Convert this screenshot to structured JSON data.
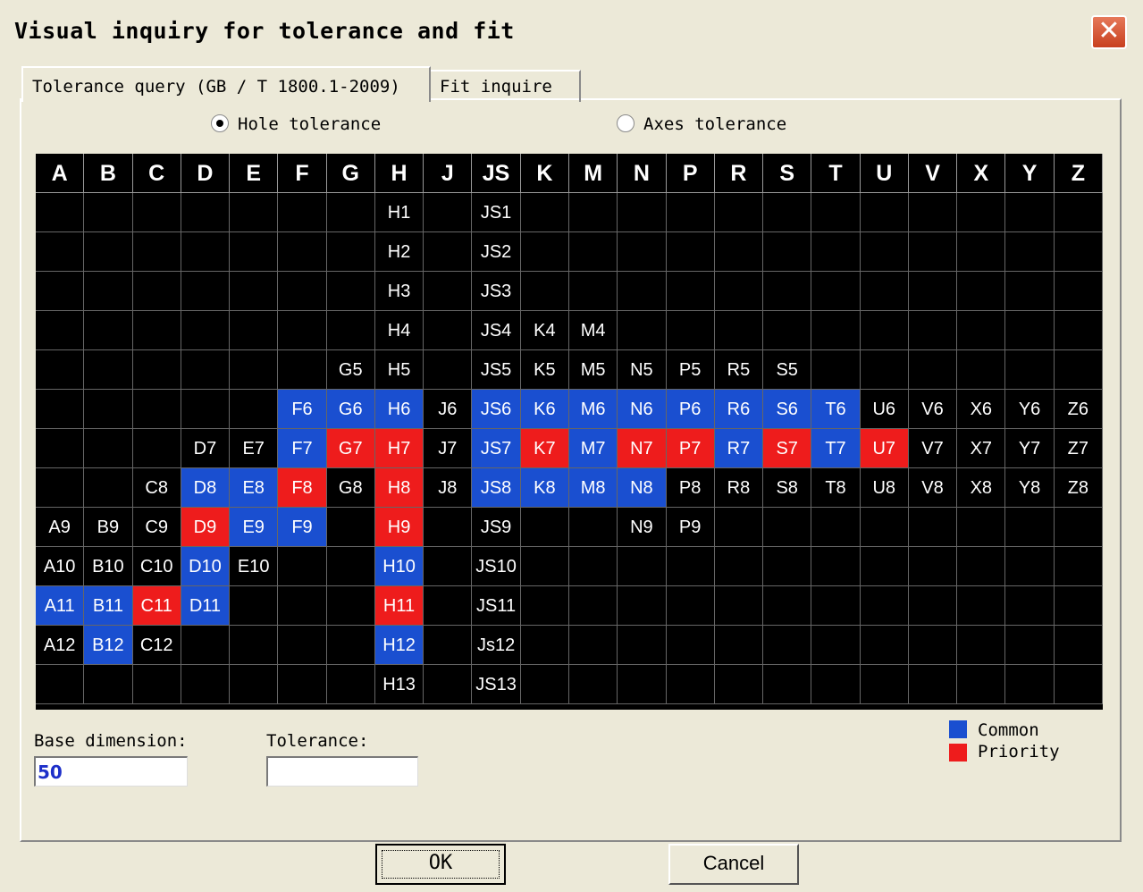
{
  "window": {
    "title": "Visual inquiry for tolerance and fit"
  },
  "tabs": [
    "Tolerance query (GB / T 1800.1-2009)",
    "Fit inquire"
  ],
  "radios": {
    "hole": "Hole tolerance",
    "axes": "Axes tolerance",
    "selected": "hole"
  },
  "grid": {
    "columns": [
      "A",
      "B",
      "C",
      "D",
      "E",
      "F",
      "G",
      "H",
      "J",
      "JS",
      "K",
      "M",
      "N",
      "P",
      "R",
      "S",
      "T",
      "U",
      "V",
      "X",
      "Y",
      "Z"
    ],
    "rows": [
      [
        [
          "",
          ""
        ],
        [
          "",
          ""
        ],
        [
          "",
          ""
        ],
        [
          "",
          ""
        ],
        [
          "",
          ""
        ],
        [
          "",
          ""
        ],
        [
          "",
          ""
        ],
        [
          "H1",
          ""
        ],
        [
          "",
          ""
        ],
        [
          "JS1",
          ""
        ],
        [
          "",
          ""
        ],
        [
          "",
          ""
        ],
        [
          "",
          ""
        ],
        [
          "",
          ""
        ],
        [
          "",
          ""
        ],
        [
          "",
          ""
        ],
        [
          "",
          ""
        ],
        [
          "",
          ""
        ],
        [
          "",
          ""
        ],
        [
          "",
          ""
        ],
        [
          "",
          ""
        ],
        [
          "",
          ""
        ]
      ],
      [
        [
          "",
          ""
        ],
        [
          "",
          ""
        ],
        [
          "",
          ""
        ],
        [
          "",
          ""
        ],
        [
          "",
          ""
        ],
        [
          "",
          ""
        ],
        [
          "",
          ""
        ],
        [
          "H2",
          ""
        ],
        [
          "",
          ""
        ],
        [
          "JS2",
          ""
        ],
        [
          "",
          ""
        ],
        [
          "",
          ""
        ],
        [
          "",
          ""
        ],
        [
          "",
          ""
        ],
        [
          "",
          ""
        ],
        [
          "",
          ""
        ],
        [
          "",
          ""
        ],
        [
          "",
          ""
        ],
        [
          "",
          ""
        ],
        [
          "",
          ""
        ],
        [
          "",
          ""
        ],
        [
          "",
          ""
        ]
      ],
      [
        [
          "",
          ""
        ],
        [
          "",
          ""
        ],
        [
          "",
          ""
        ],
        [
          "",
          ""
        ],
        [
          "",
          ""
        ],
        [
          "",
          ""
        ],
        [
          "",
          ""
        ],
        [
          "H3",
          ""
        ],
        [
          "",
          ""
        ],
        [
          "JS3",
          ""
        ],
        [
          "",
          ""
        ],
        [
          "",
          ""
        ],
        [
          "",
          ""
        ],
        [
          "",
          ""
        ],
        [
          "",
          ""
        ],
        [
          "",
          ""
        ],
        [
          "",
          ""
        ],
        [
          "",
          ""
        ],
        [
          "",
          ""
        ],
        [
          "",
          ""
        ],
        [
          "",
          ""
        ],
        [
          "",
          ""
        ]
      ],
      [
        [
          "",
          ""
        ],
        [
          "",
          ""
        ],
        [
          "",
          ""
        ],
        [
          "",
          ""
        ],
        [
          "",
          ""
        ],
        [
          "",
          ""
        ],
        [
          "",
          ""
        ],
        [
          "H4",
          ""
        ],
        [
          "",
          ""
        ],
        [
          "JS4",
          ""
        ],
        [
          "K4",
          ""
        ],
        [
          "M4",
          ""
        ],
        [
          "",
          ""
        ],
        [
          "",
          ""
        ],
        [
          "",
          ""
        ],
        [
          "",
          ""
        ],
        [
          "",
          ""
        ],
        [
          "",
          ""
        ],
        [
          "",
          ""
        ],
        [
          "",
          ""
        ],
        [
          "",
          ""
        ],
        [
          "",
          ""
        ]
      ],
      [
        [
          "",
          ""
        ],
        [
          "",
          ""
        ],
        [
          "",
          ""
        ],
        [
          "",
          ""
        ],
        [
          "",
          ""
        ],
        [
          "",
          ""
        ],
        [
          "G5",
          ""
        ],
        [
          "H5",
          ""
        ],
        [
          "",
          ""
        ],
        [
          "JS5",
          ""
        ],
        [
          "K5",
          ""
        ],
        [
          "M5",
          ""
        ],
        [
          "N5",
          ""
        ],
        [
          "P5",
          ""
        ],
        [
          "R5",
          ""
        ],
        [
          "S5",
          ""
        ],
        [
          "",
          ""
        ],
        [
          "",
          ""
        ],
        [
          "",
          ""
        ],
        [
          "",
          ""
        ],
        [
          "",
          ""
        ],
        [
          "",
          ""
        ]
      ],
      [
        [
          "",
          ""
        ],
        [
          "",
          ""
        ],
        [
          "",
          ""
        ],
        [
          "",
          ""
        ],
        [
          "",
          ""
        ],
        [
          "F6",
          "c"
        ],
        [
          "G6",
          "c"
        ],
        [
          "H6",
          "c"
        ],
        [
          "J6",
          ""
        ],
        [
          "JS6",
          "c"
        ],
        [
          "K6",
          "c"
        ],
        [
          "M6",
          "c"
        ],
        [
          "N6",
          "c"
        ],
        [
          "P6",
          "c"
        ],
        [
          "R6",
          "c"
        ],
        [
          "S6",
          "c"
        ],
        [
          "T6",
          "c"
        ],
        [
          "U6",
          ""
        ],
        [
          "V6",
          ""
        ],
        [
          "X6",
          ""
        ],
        [
          "Y6",
          ""
        ],
        [
          "Z6",
          ""
        ]
      ],
      [
        [
          "",
          ""
        ],
        [
          "",
          ""
        ],
        [
          "",
          ""
        ],
        [
          "D7",
          ""
        ],
        [
          "E7",
          ""
        ],
        [
          "F7",
          "c"
        ],
        [
          "G7",
          "p"
        ],
        [
          "H7",
          "p"
        ],
        [
          "J7",
          ""
        ],
        [
          "JS7",
          "c"
        ],
        [
          "K7",
          "p"
        ],
        [
          "M7",
          "c"
        ],
        [
          "N7",
          "p"
        ],
        [
          "P7",
          "p"
        ],
        [
          "R7",
          "c"
        ],
        [
          "S7",
          "p"
        ],
        [
          "T7",
          "c"
        ],
        [
          "U7",
          "p"
        ],
        [
          "V7",
          ""
        ],
        [
          "X7",
          ""
        ],
        [
          "Y7",
          ""
        ],
        [
          "Z7",
          ""
        ]
      ],
      [
        [
          "",
          ""
        ],
        [
          "",
          ""
        ],
        [
          "C8",
          ""
        ],
        [
          "D8",
          "c"
        ],
        [
          "E8",
          "c"
        ],
        [
          "F8",
          "p"
        ],
        [
          "G8",
          ""
        ],
        [
          "H8",
          "p"
        ],
        [
          "J8",
          ""
        ],
        [
          "JS8",
          "c"
        ],
        [
          "K8",
          "c"
        ],
        [
          "M8",
          "c"
        ],
        [
          "N8",
          "c"
        ],
        [
          "P8",
          ""
        ],
        [
          "R8",
          ""
        ],
        [
          "S8",
          ""
        ],
        [
          "T8",
          ""
        ],
        [
          "U8",
          ""
        ],
        [
          "V8",
          ""
        ],
        [
          "X8",
          ""
        ],
        [
          "Y8",
          ""
        ],
        [
          "Z8",
          ""
        ]
      ],
      [
        [
          "A9",
          ""
        ],
        [
          "B9",
          ""
        ],
        [
          "C9",
          ""
        ],
        [
          "D9",
          "p"
        ],
        [
          "E9",
          "c"
        ],
        [
          "F9",
          "c"
        ],
        [
          "",
          ""
        ],
        [
          "H9",
          "p"
        ],
        [
          "",
          ""
        ],
        [
          "JS9",
          ""
        ],
        [
          "",
          ""
        ],
        [
          "",
          ""
        ],
        [
          "N9",
          ""
        ],
        [
          "P9",
          ""
        ],
        [
          "",
          ""
        ],
        [
          "",
          ""
        ],
        [
          "",
          ""
        ],
        [
          "",
          ""
        ],
        [
          "",
          ""
        ],
        [
          "",
          ""
        ],
        [
          "",
          ""
        ],
        [
          "",
          ""
        ]
      ],
      [
        [
          "A10",
          ""
        ],
        [
          "B10",
          ""
        ],
        [
          "C10",
          ""
        ],
        [
          "D10",
          "c"
        ],
        [
          "E10",
          ""
        ],
        [
          "",
          ""
        ],
        [
          "",
          ""
        ],
        [
          "H10",
          "c"
        ],
        [
          "",
          ""
        ],
        [
          "JS10",
          ""
        ],
        [
          "",
          ""
        ],
        [
          "",
          ""
        ],
        [
          "",
          ""
        ],
        [
          "",
          ""
        ],
        [
          "",
          ""
        ],
        [
          "",
          ""
        ],
        [
          "",
          ""
        ],
        [
          "",
          ""
        ],
        [
          "",
          ""
        ],
        [
          "",
          ""
        ],
        [
          "",
          ""
        ],
        [
          "",
          ""
        ]
      ],
      [
        [
          "A11",
          "c"
        ],
        [
          "B11",
          "c"
        ],
        [
          "C11",
          "p"
        ],
        [
          "D11",
          "c"
        ],
        [
          "",
          ""
        ],
        [
          "",
          ""
        ],
        [
          "",
          ""
        ],
        [
          "H11",
          "p"
        ],
        [
          "",
          ""
        ],
        [
          "JS11",
          ""
        ],
        [
          "",
          ""
        ],
        [
          "",
          ""
        ],
        [
          "",
          ""
        ],
        [
          "",
          ""
        ],
        [
          "",
          ""
        ],
        [
          "",
          ""
        ],
        [
          "",
          ""
        ],
        [
          "",
          ""
        ],
        [
          "",
          ""
        ],
        [
          "",
          ""
        ],
        [
          "",
          ""
        ],
        [
          "",
          ""
        ]
      ],
      [
        [
          "A12",
          ""
        ],
        [
          "B12",
          "c"
        ],
        [
          "C12",
          ""
        ],
        [
          "",
          ""
        ],
        [
          "",
          ""
        ],
        [
          "",
          ""
        ],
        [
          "",
          ""
        ],
        [
          "H12",
          "c"
        ],
        [
          "",
          ""
        ],
        [
          "Js12",
          ""
        ],
        [
          "",
          ""
        ],
        [
          "",
          ""
        ],
        [
          "",
          ""
        ],
        [
          "",
          ""
        ],
        [
          "",
          ""
        ],
        [
          "",
          ""
        ],
        [
          "",
          ""
        ],
        [
          "",
          ""
        ],
        [
          "",
          ""
        ],
        [
          "",
          ""
        ],
        [
          "",
          ""
        ],
        [
          "",
          ""
        ]
      ],
      [
        [
          "",
          ""
        ],
        [
          "",
          ""
        ],
        [
          "",
          ""
        ],
        [
          "",
          ""
        ],
        [
          "",
          ""
        ],
        [
          "",
          ""
        ],
        [
          "",
          ""
        ],
        [
          "H13",
          ""
        ],
        [
          "",
          ""
        ],
        [
          "JS13",
          ""
        ],
        [
          "",
          ""
        ],
        [
          "",
          ""
        ],
        [
          "",
          ""
        ],
        [
          "",
          ""
        ],
        [
          "",
          ""
        ],
        [
          "",
          ""
        ],
        [
          "",
          ""
        ],
        [
          "",
          ""
        ],
        [
          "",
          ""
        ],
        [
          "",
          ""
        ],
        [
          "",
          ""
        ],
        [
          "",
          ""
        ]
      ]
    ]
  },
  "fields": {
    "base_label": "Base dimension:",
    "base_value": "50",
    "tolerance_label": "Tolerance:",
    "tolerance_value": ""
  },
  "legend": {
    "common": "Common",
    "priority": "Priority"
  },
  "colors": {
    "common": "#1a4fd0",
    "priority": "#ee1c1c"
  },
  "buttons": {
    "ok": "OK",
    "cancel": "Cancel"
  }
}
